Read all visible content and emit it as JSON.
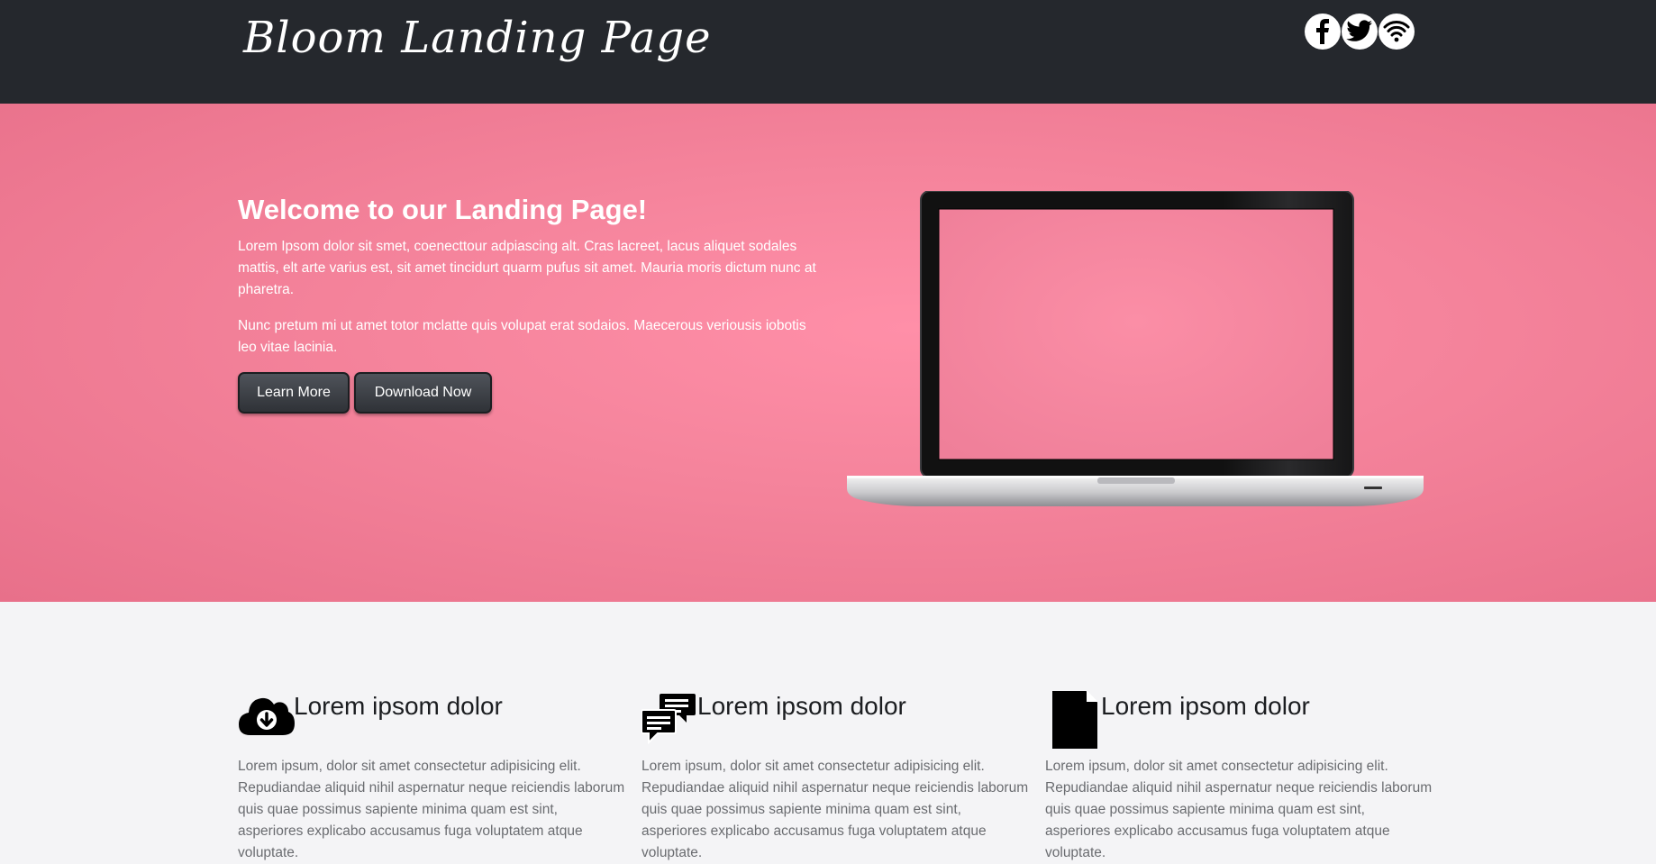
{
  "header": {
    "logo_text": "Bloom Landing Page",
    "social": [
      {
        "icon": "facebook-icon"
      },
      {
        "icon": "twitter-icon"
      },
      {
        "icon": "wifi-icon"
      }
    ]
  },
  "hero": {
    "title": "Welcome to our Landing Page!",
    "paragraph1": "Lorem Ipsom dolor sit smet, coenecttour adpiascing alt. Cras lacreet, lacus aliquet sodales mattis, elt arte varius est, sit amet tincidurt quarm pufus sit amet. Mauria moris dictum nunc at pharetra.",
    "paragraph2": "Nunc pretum mi ut amet totor mclatte quis volupat erat sodaios. Maecerous veriousis iobotis leo vitae lacinia.",
    "learn_more_label": "Learn More",
    "download_label": "Download Now",
    "image": "laptop-image"
  },
  "features": [
    {
      "icon": "cloud-download-icon",
      "title": "Lorem ipsom dolor",
      "text": "Lorem ipsum, dolor sit amet consectetur adipisicing elit. Repudiandae aliquid nihil aspernatur neque reiciendis laborum quis quae possimus sapiente minima quam est sint, asperiores explicabo accusamus fuga voluptatem atque voluptate."
    },
    {
      "icon": "chat-bubbles-icon",
      "title": "Lorem ipsom dolor",
      "text": "Lorem ipsum, dolor sit amet consectetur adipisicing elit. Repudiandae aliquid nihil aspernatur neque reiciendis laborum quis quae possimus sapiente minima quam est sint, asperiores explicabo accusamus fuga voluptatem atque voluptate."
    },
    {
      "icon": "document-icon",
      "title": "Lorem ipsom dolor",
      "text": "Lorem ipsum, dolor sit amet consectetur adipisicing elit. Repudiandae aliquid nihil aspernatur neque reiciendis laborum quis quae possimus sapiente minima quam est sint, asperiores explicabo accusamus fuga voluptatem atque voluptate."
    }
  ],
  "colors": {
    "header_bg": "#25282d",
    "hero_pink": "#f5849c",
    "button_dark": "#3a3d42",
    "features_bg": "#f4f4f6"
  }
}
